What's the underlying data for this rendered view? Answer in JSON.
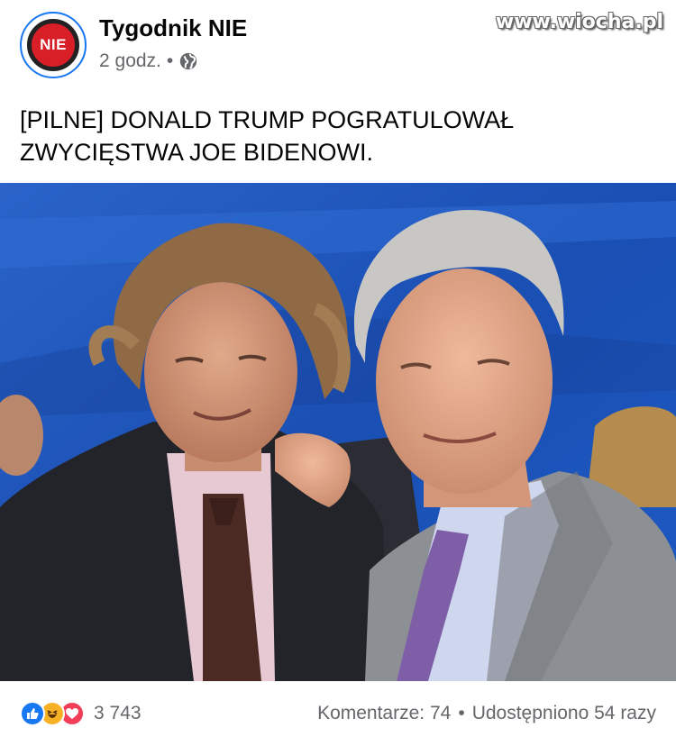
{
  "watermark": "www.wiocha.pl",
  "page": {
    "name": "Tygodnik NIE",
    "avatar_text": "NIE",
    "time": "2 godz.",
    "separator": "•",
    "privacy_icon": "globe-icon"
  },
  "post": {
    "text": "[PILNE] DONALD TRUMP POGRATULOWAŁ\nZWYCIĘSTWA JOE BIDENOWI."
  },
  "footer": {
    "reaction_icons": [
      "like-icon",
      "haha-icon",
      "love-icon"
    ],
    "reaction_count": "3 743",
    "comments": "Komentarze: 74",
    "separator": "•",
    "shares": "Udostępniono 54 razy"
  },
  "colors": {
    "brand_blue": "#1877f2",
    "secondary_text": "#65676b",
    "stop_red": "#d81e27",
    "love": "#f33e58",
    "haha": "#f7b125"
  }
}
